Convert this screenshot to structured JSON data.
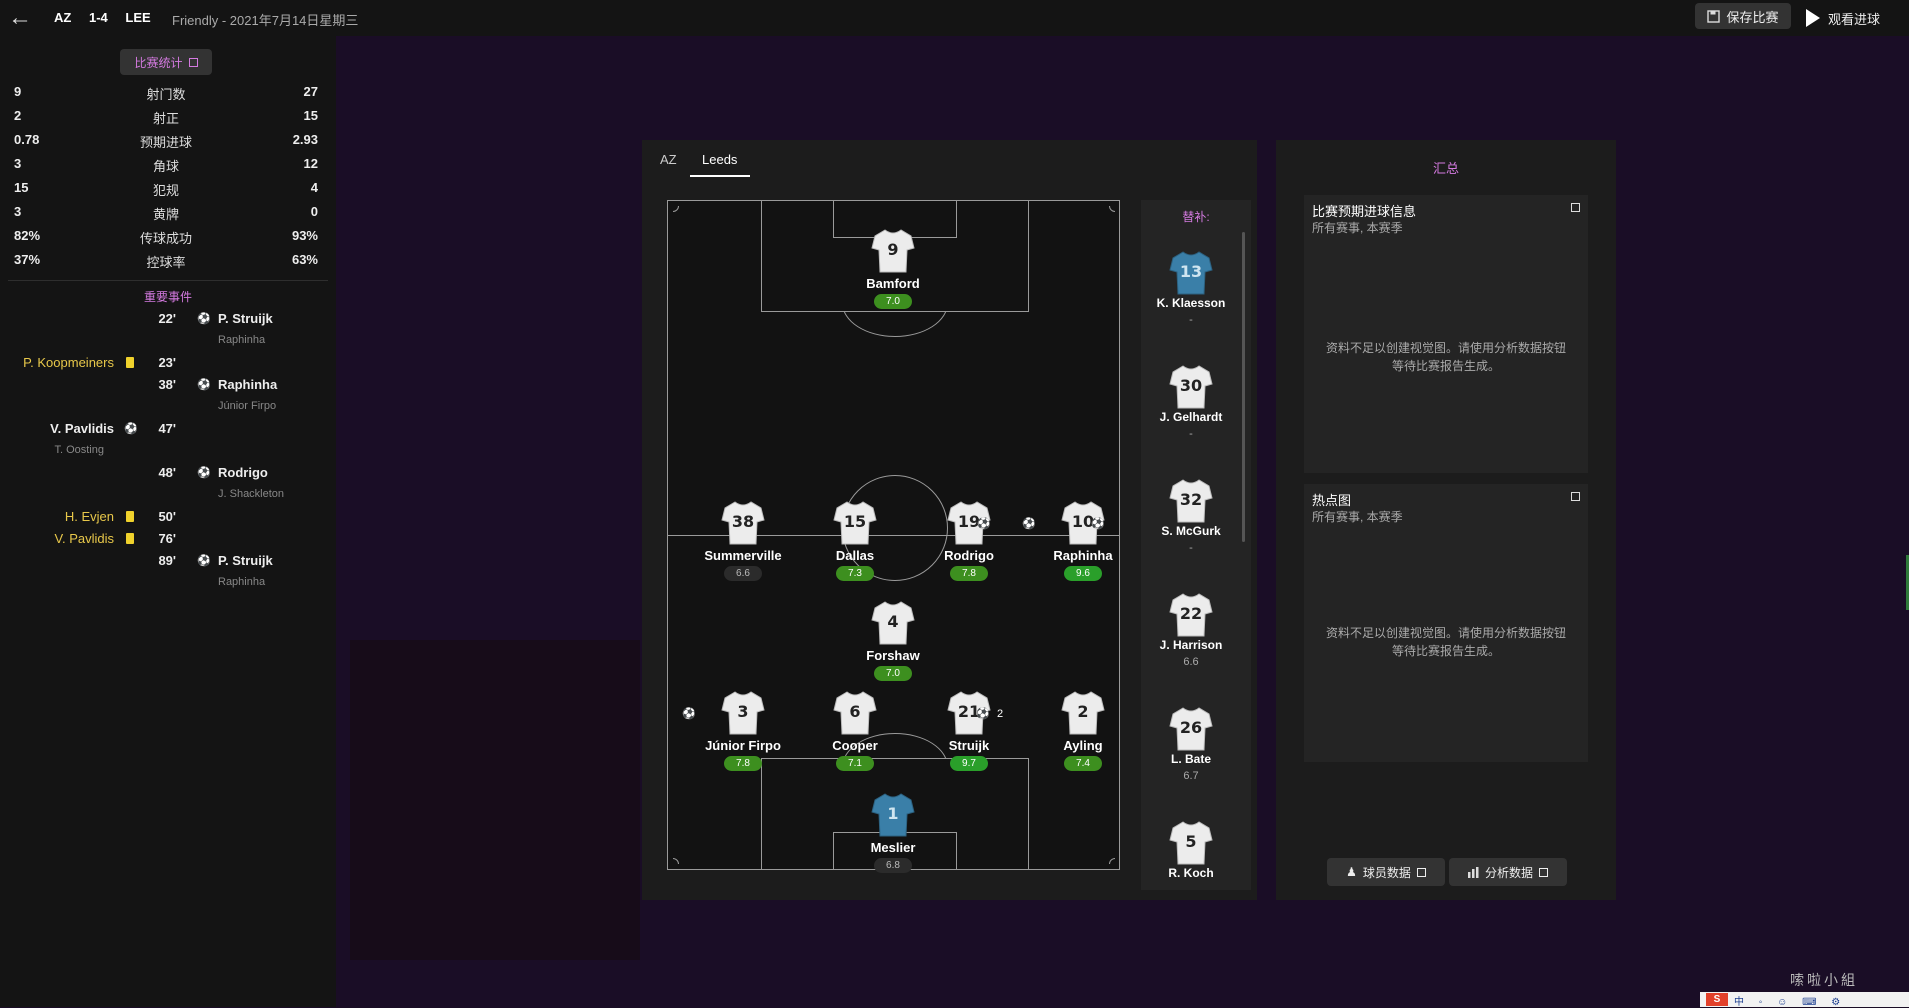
{
  "header": {
    "home_abbr": "AZ",
    "score": "1-4",
    "away_abbr": "LEE",
    "match_info": "Friendly - 2021年7月14日星期三",
    "save_label": "保存比赛",
    "watch_label": "观看进球",
    "back_icon": "arrow-left-icon"
  },
  "stats": {
    "button_label": "比赛统计",
    "rows": [
      {
        "label": "射门数",
        "home": "9",
        "away": "27"
      },
      {
        "label": "射正",
        "home": "2",
        "away": "15"
      },
      {
        "label": "预期进球",
        "home": "0.78",
        "away": "2.93"
      },
      {
        "label": "角球",
        "home": "3",
        "away": "12"
      },
      {
        "label": "犯规",
        "home": "15",
        "away": "4"
      },
      {
        "label": "黄牌",
        "home": "3",
        "away": "0"
      },
      {
        "label": "传球成功",
        "home": "82%",
        "away": "93%"
      },
      {
        "label": "控球率",
        "home": "37%",
        "away": "63%"
      }
    ]
  },
  "events": {
    "title": "重要事件",
    "items": [
      {
        "minute": "22'",
        "side": "away",
        "type": "goal",
        "player": "P. Struijk",
        "assist": "Raphinha"
      },
      {
        "minute": "23'",
        "side": "home",
        "type": "yellow",
        "player": "P. Koopmeiners",
        "assist": ""
      },
      {
        "minute": "38'",
        "side": "away",
        "type": "goal",
        "player": "Raphinha",
        "assist": "Júnior Firpo"
      },
      {
        "minute": "47'",
        "side": "home",
        "type": "goal",
        "player": "V. Pavlidis",
        "assist": "T. Oosting"
      },
      {
        "minute": "48'",
        "side": "away",
        "type": "goal",
        "player": "Rodrigo",
        "assist": "J. Shackleton"
      },
      {
        "minute": "50'",
        "side": "home",
        "type": "yellow",
        "player": "H. Evjen",
        "assist": ""
      },
      {
        "minute": "76'",
        "side": "home",
        "type": "yellow",
        "player": "V. Pavlidis",
        "assist": ""
      },
      {
        "minute": "89'",
        "side": "away",
        "type": "goal",
        "player": "P. Struijk",
        "assist": "Raphinha"
      }
    ]
  },
  "lineup": {
    "tabs": [
      "AZ",
      "Leeds"
    ],
    "active_tab": "Leeds",
    "players": [
      {
        "number": "9",
        "name": "Bamford",
        "rating": "7.0",
        "rating_style": "g",
        "gk": false
      },
      {
        "number": "38",
        "name": "Summerville",
        "rating": "6.6",
        "rating_style": "n",
        "gk": false
      },
      {
        "number": "15",
        "name": "Dallas",
        "rating": "7.3",
        "rating_style": "g",
        "gk": false
      },
      {
        "number": "19",
        "name": "Rodrigo",
        "rating": "7.8",
        "rating_style": "g",
        "gk": false
      },
      {
        "number": "10",
        "name": "Raphinha",
        "rating": "9.6",
        "rating_style": "bg",
        "gk": false
      },
      {
        "number": "4",
        "name": "Forshaw",
        "rating": "7.0",
        "rating_style": "g",
        "gk": false
      },
      {
        "number": "3",
        "name": "Júnior Firpo",
        "rating": "7.8",
        "rating_style": "g",
        "gk": false
      },
      {
        "number": "6",
        "name": "Cooper",
        "rating": "7.1",
        "rating_style": "g",
        "gk": false
      },
      {
        "number": "21",
        "name": "Struijk",
        "rating": "9.7",
        "rating_style": "bg",
        "gk": false
      },
      {
        "number": "2",
        "name": "Ayling",
        "rating": "7.4",
        "rating_style": "g",
        "gk": false
      },
      {
        "number": "1",
        "name": "Meslier",
        "rating": "6.8",
        "rating_style": "n",
        "gk": true
      }
    ],
    "struijk_goals": "2",
    "subs_title": "替补:",
    "subs": [
      {
        "number": "13",
        "name": "K. Klaesson",
        "rating": "-",
        "gk": true
      },
      {
        "number": "30",
        "name": "J. Gelhardt",
        "rating": "-",
        "gk": false
      },
      {
        "number": "32",
        "name": "S. McGurk",
        "rating": "-",
        "gk": false
      },
      {
        "number": "22",
        "name": "J. Harrison",
        "rating": "6.6",
        "gk": false
      },
      {
        "number": "26",
        "name": "L. Bate",
        "rating": "6.7",
        "gk": false
      },
      {
        "number": "5",
        "name": "R. Koch",
        "rating": "",
        "gk": false
      }
    ]
  },
  "summary": {
    "title": "汇总",
    "xg_card": {
      "title": "比赛预期进球信息",
      "subtitle": "所有赛事, 本赛季",
      "message_1": "资料不足以创建视觉图。请使用分析数据按钮",
      "message_2": "等待比赛报告生成。"
    },
    "heatmap_card": {
      "title": "热点图",
      "subtitle": "所有赛事, 本赛季",
      "message_1": "资料不足以创建视觉图。请使用分析数据按钮",
      "message_2": "等待比赛报告生成。"
    },
    "player_data_label": "球员数据",
    "analysis_label": "分析数据"
  },
  "watermark": {
    "text": "嗦啦小組"
  },
  "colors": {
    "accent": "#d47ae0",
    "rating_green": "#3d8f1f",
    "yellow_card": "#f0d22c",
    "gk_shirt": "#3a7fa8"
  }
}
